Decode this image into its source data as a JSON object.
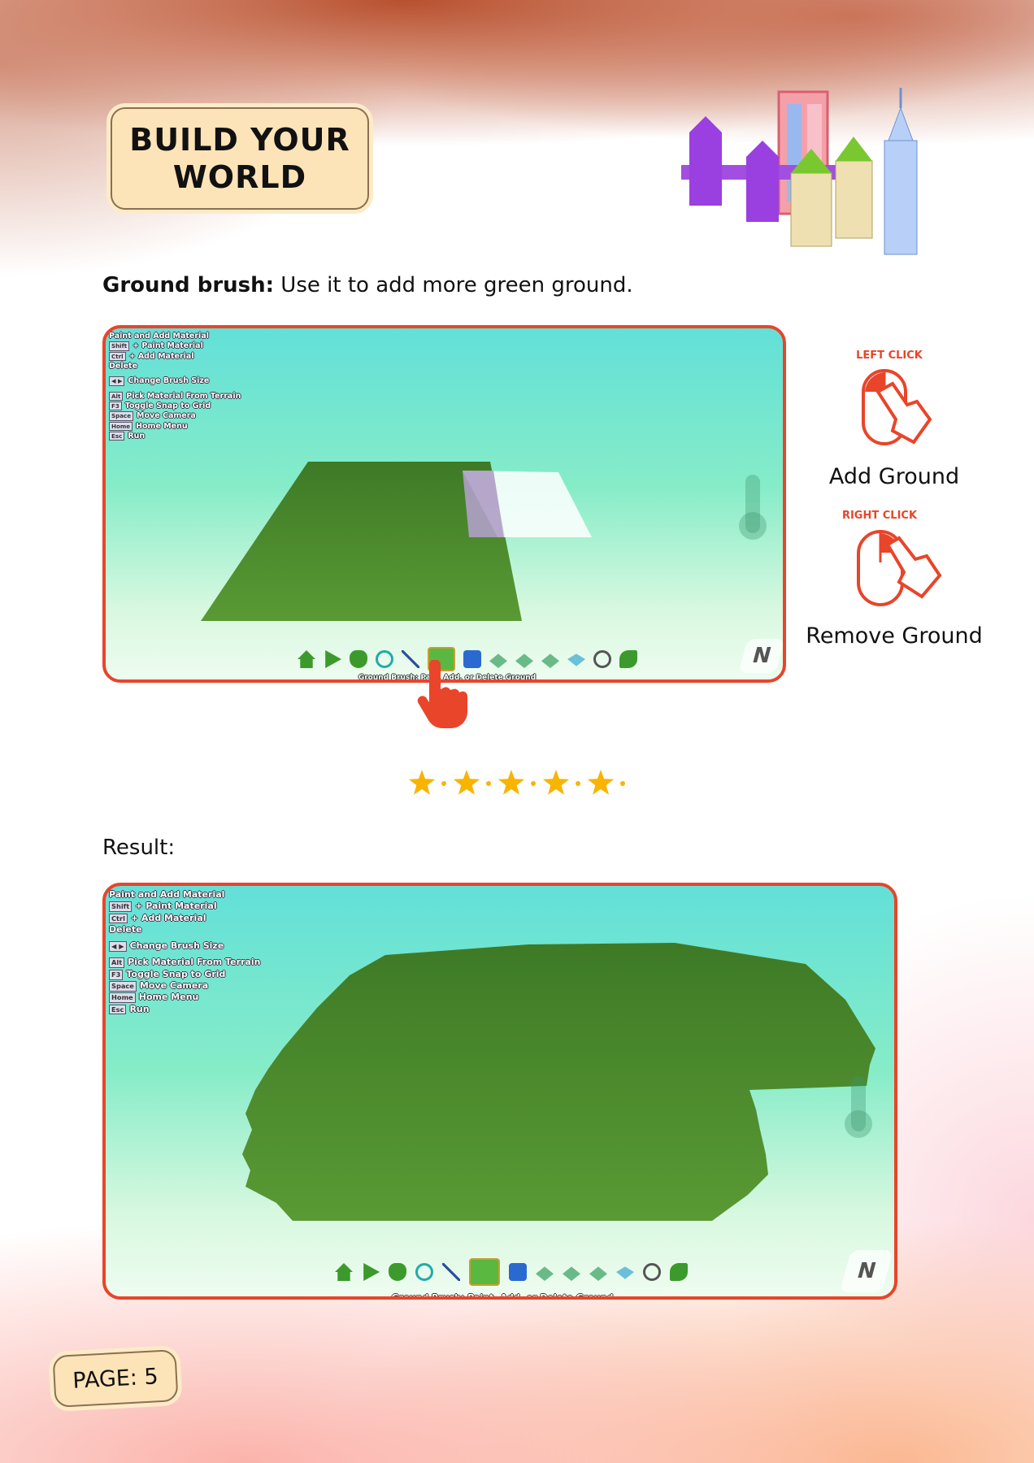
{
  "title": {
    "line1": "BUILD YOUR",
    "line2": "WORLD"
  },
  "instruction": {
    "bold": "Ground brush:",
    "text": " Use it to add more green ground."
  },
  "shortcuts": [
    {
      "key": "",
      "label": "Paint and Add Material"
    },
    {
      "key": "Shift",
      "label": "+ Paint Material"
    },
    {
      "key": "Ctrl",
      "label": "+ Add Material"
    },
    {
      "key": "",
      "label": "Delete"
    },
    {
      "key": "◀ ▶",
      "label": "Change Brush Size"
    },
    {
      "key": "Alt",
      "label": "Pick Material From Terrain"
    },
    {
      "key": "F3",
      "label": "Toggle Snap to Grid"
    },
    {
      "key": "Space",
      "label": "Move Camera"
    },
    {
      "key": "Home",
      "label": "Home Menu"
    },
    {
      "key": "Esc",
      "label": "Run"
    }
  ],
  "toolbar": {
    "tooltip": "Ground Brush: Paint, Add, or Delete Ground",
    "tooltip_partial": "Ground Brush: Pa…, Add, or Delete Ground",
    "icons": [
      "home-icon",
      "play-icon",
      "hand-icon",
      "timer-icon",
      "path-icon",
      "ground-brush-icon",
      "terrain-raise-icon",
      "terrain-lower-icon",
      "terrain-smooth-icon",
      "water-icon",
      "sky-icon",
      "tools-icon"
    ]
  },
  "compass": "N",
  "mouse": {
    "left_click": "LEFT CLICK",
    "left_action": "Add Ground",
    "right_click": "RIGHT CLICK",
    "right_action": "Remove Ground"
  },
  "result_label": "Result:",
  "page": "PAGE: 5",
  "colors": {
    "accent": "#e8452a",
    "ground": "#4f8a2c",
    "star": "#f8b400"
  }
}
